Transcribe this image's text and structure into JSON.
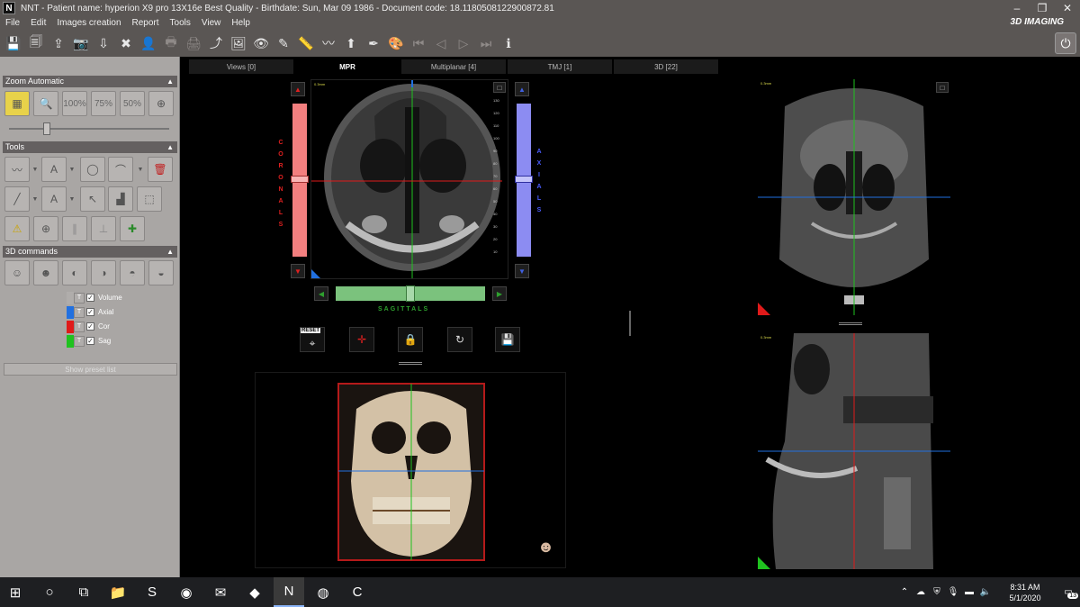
{
  "window": {
    "title": "NNT - Patient name: hyperion X9 pro 13X16e  Best Quality - Birthdate: Sun, Mar 09 1986 - Document code: 18.1180508122900872.81",
    "logo_letter": "N",
    "brand": "3D IMAGING",
    "controls": [
      "–",
      "❐",
      "✕"
    ]
  },
  "menu": [
    "File",
    "Edit",
    "Images creation",
    "Report",
    "Tools",
    "View",
    "Help"
  ],
  "toolbar": {
    "icons": [
      "save-icon",
      "save-all-icon",
      "export-icon",
      "snapshot-icon",
      "import-icon",
      "delete-icon",
      "patient-icon",
      "print-preview-icon",
      "print-icon",
      "share-icon",
      "image-edit-icon",
      "eye-icon",
      "brush-icon",
      "ruler-icon",
      "nerve-icon",
      "implant-icon",
      "pen-icon",
      "color-icon",
      "first-frame-icon",
      "prev-frame-icon",
      "play-icon",
      "next-frame-icon",
      "info-icon"
    ],
    "glyphs": [
      "💾",
      "🗐",
      "⇪",
      "📷",
      "⇩",
      "✖",
      "👤",
      "🖶",
      "🖨",
      "⤴",
      "🖼",
      "👁",
      "✎",
      "📏",
      "〰",
      "⬆",
      "✒",
      "🎨",
      "⏮",
      "◁",
      "▷",
      "⏭",
      "ℹ"
    ]
  },
  "left_panel": {
    "zoom": {
      "header": "Zoom Automatic",
      "buttons": [
        "100%",
        "75%",
        "50%"
      ]
    },
    "tools_header": "Tools",
    "commands_header": "3D commands",
    "legend": [
      {
        "label": "Volume",
        "color": "#b0adab",
        "checked": true
      },
      {
        "label": "Axial",
        "color": "#2170e0",
        "checked": true
      },
      {
        "label": "Cor",
        "color": "#e01a1a",
        "checked": true
      },
      {
        "label": "Sag",
        "color": "#1fc21f",
        "checked": true
      }
    ],
    "legend_t": "T",
    "preset_button": "Show preset list"
  },
  "tabs": [
    {
      "label": "Views [0]",
      "active": false
    },
    {
      "label": "MPR",
      "active": true
    },
    {
      "label": "Multiplanar [4]",
      "active": false
    },
    {
      "label": "TMJ [1]",
      "active": false
    },
    {
      "label": "3D [22]",
      "active": false
    }
  ],
  "mpr": {
    "coronal_letters": "CORONALS",
    "axial_letters": "AXIALS",
    "sagittal_label": "SAGITTALS",
    "reset_label": "RESET",
    "view_scale": "0.3mm",
    "coronal_color": "#f27f7f",
    "axial_color": "#8c8cf2",
    "sagittal_color": "#7bc27d",
    "rulers": [
      "130",
      "120",
      "110",
      "100",
      "90",
      "80",
      "70",
      "60",
      "50",
      "40",
      "30",
      "20",
      "10"
    ]
  },
  "taskbar": {
    "apps": [
      "start-icon",
      "cortana-icon",
      "task-view-icon",
      "explorer-icon",
      "skype-icon",
      "chrome-icon",
      "outlook-icon",
      "visual-studio-icon",
      "nnt-icon",
      "firefox-icon",
      "app-icon"
    ],
    "glyphs": [
      "⊞",
      "○",
      "⧉",
      "📁",
      "S",
      "◉",
      "✉",
      "◆",
      "N",
      "◍",
      "C"
    ],
    "time": "8:31 AM",
    "date": "5/1/2020",
    "notification_count": "13"
  }
}
